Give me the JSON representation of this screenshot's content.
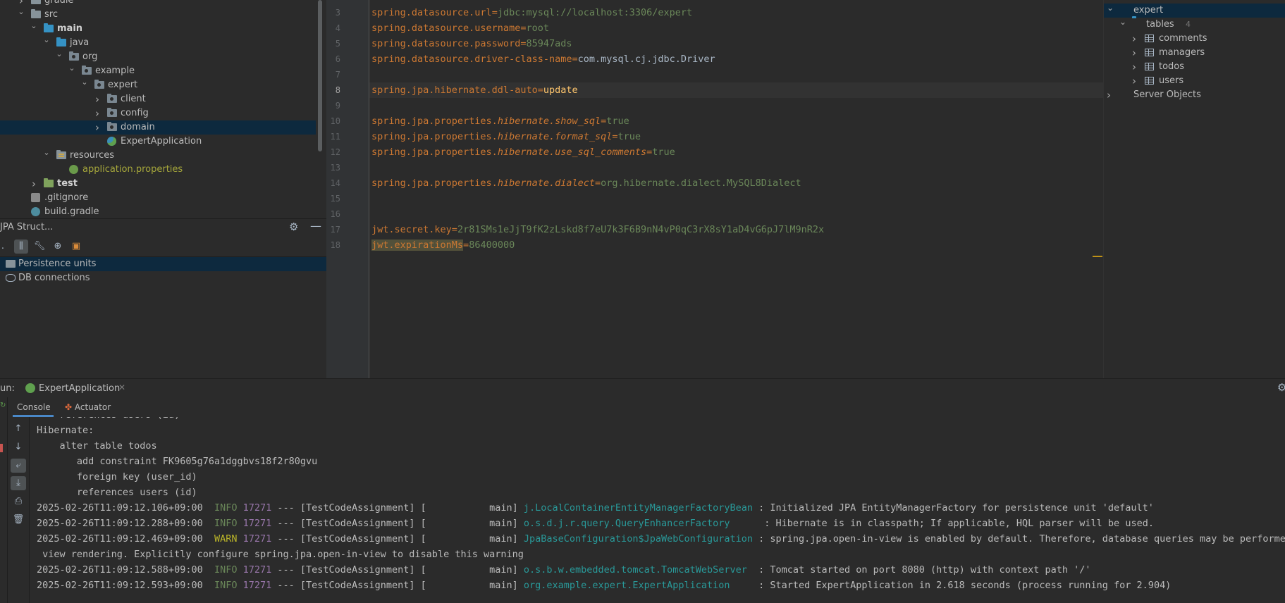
{
  "project_tree": [
    {
      "label": "gradle",
      "depth": 1,
      "icon": "folder-icon",
      "expanded": false
    },
    {
      "label": "src",
      "depth": 1,
      "icon": "folder-icon",
      "expanded": true
    },
    {
      "label": "main",
      "depth": 2,
      "icon": "module-folder-icon",
      "expanded": true,
      "bold": true
    },
    {
      "label": "java",
      "depth": 3,
      "icon": "source-folder-icon",
      "expanded": true
    },
    {
      "label": "org",
      "depth": 4,
      "icon": "package-icon",
      "expanded": true
    },
    {
      "label": "example",
      "depth": 5,
      "icon": "package-icon",
      "expanded": true
    },
    {
      "label": "expert",
      "depth": 6,
      "icon": "package-icon",
      "expanded": true
    },
    {
      "label": "client",
      "depth": 7,
      "icon": "package-icon",
      "expanded": false
    },
    {
      "label": "config",
      "depth": 7,
      "icon": "package-icon",
      "expanded": false
    },
    {
      "label": "domain",
      "depth": 7,
      "icon": "package-icon",
      "expanded": false,
      "selected": true
    },
    {
      "label": "ExpertApplication",
      "depth": 7,
      "icon": "spring-boot-class-icon",
      "leaf": true
    },
    {
      "label": "resources",
      "depth": 3,
      "icon": "resources-folder-icon",
      "expanded": true
    },
    {
      "label": "application.properties",
      "depth": 4,
      "icon": "spring-properties-icon",
      "leaf": true,
      "color": "#a6a73b"
    },
    {
      "label": "test",
      "depth": 2,
      "icon": "test-folder-icon",
      "expanded": false,
      "bold": true
    },
    {
      "label": ".gitignore",
      "depth": 1,
      "icon": "gitignore-icon",
      "leaf": true
    },
    {
      "label": "build.gradle",
      "depth": 1,
      "icon": "gradle-icon",
      "leaf": true
    }
  ],
  "jpa_panel": {
    "title": "JPA Struct...",
    "tree": [
      {
        "label": "Persistence units",
        "selected": true
      },
      {
        "label": "DB connections",
        "selected": false
      }
    ]
  },
  "editor": {
    "lines": [
      {
        "n": "3",
        "key": "spring.datasource.url",
        "val": "jdbc:mysql://localhost:3306/expert"
      },
      {
        "n": "4",
        "key": "spring.datasource.username",
        "val": "root"
      },
      {
        "n": "5",
        "key": "spring.datasource.password",
        "val": "85947ads"
      },
      {
        "n": "6",
        "key": "spring.datasource.driver-class-name",
        "val": "com.mysql.cj.jdbc.Driver"
      },
      {
        "n": "7"
      },
      {
        "n": "8",
        "key": "spring.jpa.hibernate.ddl-auto",
        "val": "update"
      },
      {
        "n": "9"
      },
      {
        "n": "10",
        "key_prefix": "spring.jpa.properties.",
        "key_italic": "hibernate.show_sql",
        "val": "true"
      },
      {
        "n": "11",
        "key_prefix": "spring.jpa.properties.",
        "key_italic": "hibernate.format_sql",
        "val": "true"
      },
      {
        "n": "12",
        "key_prefix": "spring.jpa.properties.",
        "key_italic": "hibernate.use_sql_comments",
        "val": "true"
      },
      {
        "n": "13"
      },
      {
        "n": "14",
        "key_prefix": "spring.jpa.properties.",
        "key_italic": "hibernate.dialect",
        "val": "org.hibernate.dialect.MySQL8Dialect"
      },
      {
        "n": "15"
      },
      {
        "n": "16"
      },
      {
        "n": "17",
        "key": "jwt.secret.key",
        "val": "2r81SMs1eJjT9fK2zLskd8f7eU7k3F6B9nN4vP0qC3rX8sY1aD4vG6pJ7lM9nR2x"
      },
      {
        "n": "18",
        "key": "jwt.expirationMs",
        "val": "86400000"
      }
    ]
  },
  "db_panel": {
    "tree": [
      {
        "label": "expert",
        "depth": 1,
        "expanded": true,
        "selected": true,
        "icon": "schema-icon"
      },
      {
        "label": "tables",
        "count": "4",
        "depth": 2,
        "expanded": true,
        "icon": "folder-icon"
      },
      {
        "label": "comments",
        "depth": 3,
        "icon": "table-icon"
      },
      {
        "label": "managers",
        "depth": 3,
        "icon": "table-icon"
      },
      {
        "label": "todos",
        "depth": 3,
        "icon": "table-icon"
      },
      {
        "label": "users",
        "depth": 3,
        "icon": "table-icon"
      },
      {
        "label": "Server Objects",
        "depth": 1,
        "expanded": false,
        "icon": "server-objects-icon"
      }
    ]
  },
  "run": {
    "label": "un:",
    "config_tab": "ExpertApplication",
    "tabs": [
      "Console",
      "Actuator"
    ],
    "console_lines": [
      {
        "text": "    references users (id)"
      },
      {
        "text": "Hibernate: "
      },
      {
        "text": "    alter table todos "
      },
      {
        "text": "       add constraint FK9605g76a1dggbvs18f2r80gvu "
      },
      {
        "text": "       foreign key (user_id) "
      },
      {
        "text": "       references users (id)"
      },
      {
        "ts": "2025-02-26T11:09:12.106+09:00",
        "level": "INFO",
        "pid": "17271",
        "mid": " --- [TestCodeAssignment] [           main] ",
        "logger": "j.LocalContainerEntityManagerFactoryBean",
        "msg": " : Initialized JPA EntityManagerFactory for persistence unit 'default'"
      },
      {
        "ts": "2025-02-26T11:09:12.288+09:00",
        "level": "INFO",
        "pid": "17271",
        "mid": " --- [TestCodeAssignment] [           main] ",
        "logger": "o.s.d.j.r.query.QueryEnhancerFactory     ",
        "msg": " : Hibernate is in classpath; If applicable, HQL parser will be used."
      },
      {
        "ts": "2025-02-26T11:09:12.469+09:00",
        "level": "WARN",
        "pid": "17271",
        "mid": " --- [TestCodeAssignment] [           main] ",
        "logger": "JpaBaseConfiguration$JpaWebConfiguration",
        "msg": " : spring.jpa.open-in-view is enabled by default. Therefore, database queries may be performed during"
      },
      {
        "text": " view rendering. Explicitly configure spring.jpa.open-in-view to disable this warning"
      },
      {
        "ts": "2025-02-26T11:09:12.588+09:00",
        "level": "INFO",
        "pid": "17271",
        "mid": " --- [TestCodeAssignment] [           main] ",
        "logger": "o.s.b.w.embedded.tomcat.TomcatWebServer ",
        "msg": " : Tomcat started on port 8080 (http) with context path '/'"
      },
      {
        "ts": "2025-02-26T11:09:12.593+09:00",
        "level": "INFO",
        "pid": "17271",
        "mid": " --- [TestCodeAssignment] [           main] ",
        "logger": "org.example.expert.ExpertApplication    ",
        "msg": " : Started ExpertApplication in 2.618 seconds (process running for 2.904)"
      }
    ]
  },
  "colors": {
    "background": "#2b2b2b",
    "selection": "#0d293e",
    "key": "#cc7832",
    "value": "#6a8759",
    "logger": "#299999",
    "pid": "#9876aa"
  }
}
